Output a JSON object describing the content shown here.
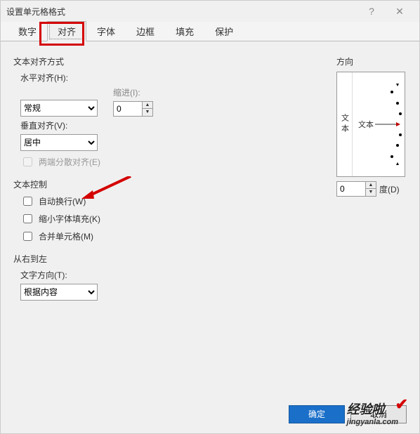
{
  "title": "设置单元格格式",
  "tabs": [
    "数字",
    "对齐",
    "字体",
    "边框",
    "填充",
    "保护"
  ],
  "active_tab_index": 1,
  "left": {
    "group_alignment": "文本对齐方式",
    "h_align_label": "水平对齐(H):",
    "h_align_value": "常规",
    "indent_label": "缩进(I):",
    "indent_value": "0",
    "v_align_label": "垂直对齐(V):",
    "v_align_value": "居中",
    "distributed_label": "两端分散对齐(E)",
    "group_textcontrol": "文本控制",
    "wrap_label": "自动换行(W)",
    "shrink_label": "缩小字体填充(K)",
    "merge_label": "合并单元格(M)",
    "group_rtl": "从右到左",
    "text_dir_label": "文字方向(T):",
    "text_dir_value": "根据内容"
  },
  "right": {
    "group_orientation": "方向",
    "vertical_text": "文本",
    "center_text": "文本",
    "degree_value": "0",
    "degree_label": "度(D)"
  },
  "buttons": {
    "ok": "确定",
    "cancel": "取消"
  },
  "watermark": {
    "line1": "经验啦",
    "line2": "jingyanla.com"
  }
}
